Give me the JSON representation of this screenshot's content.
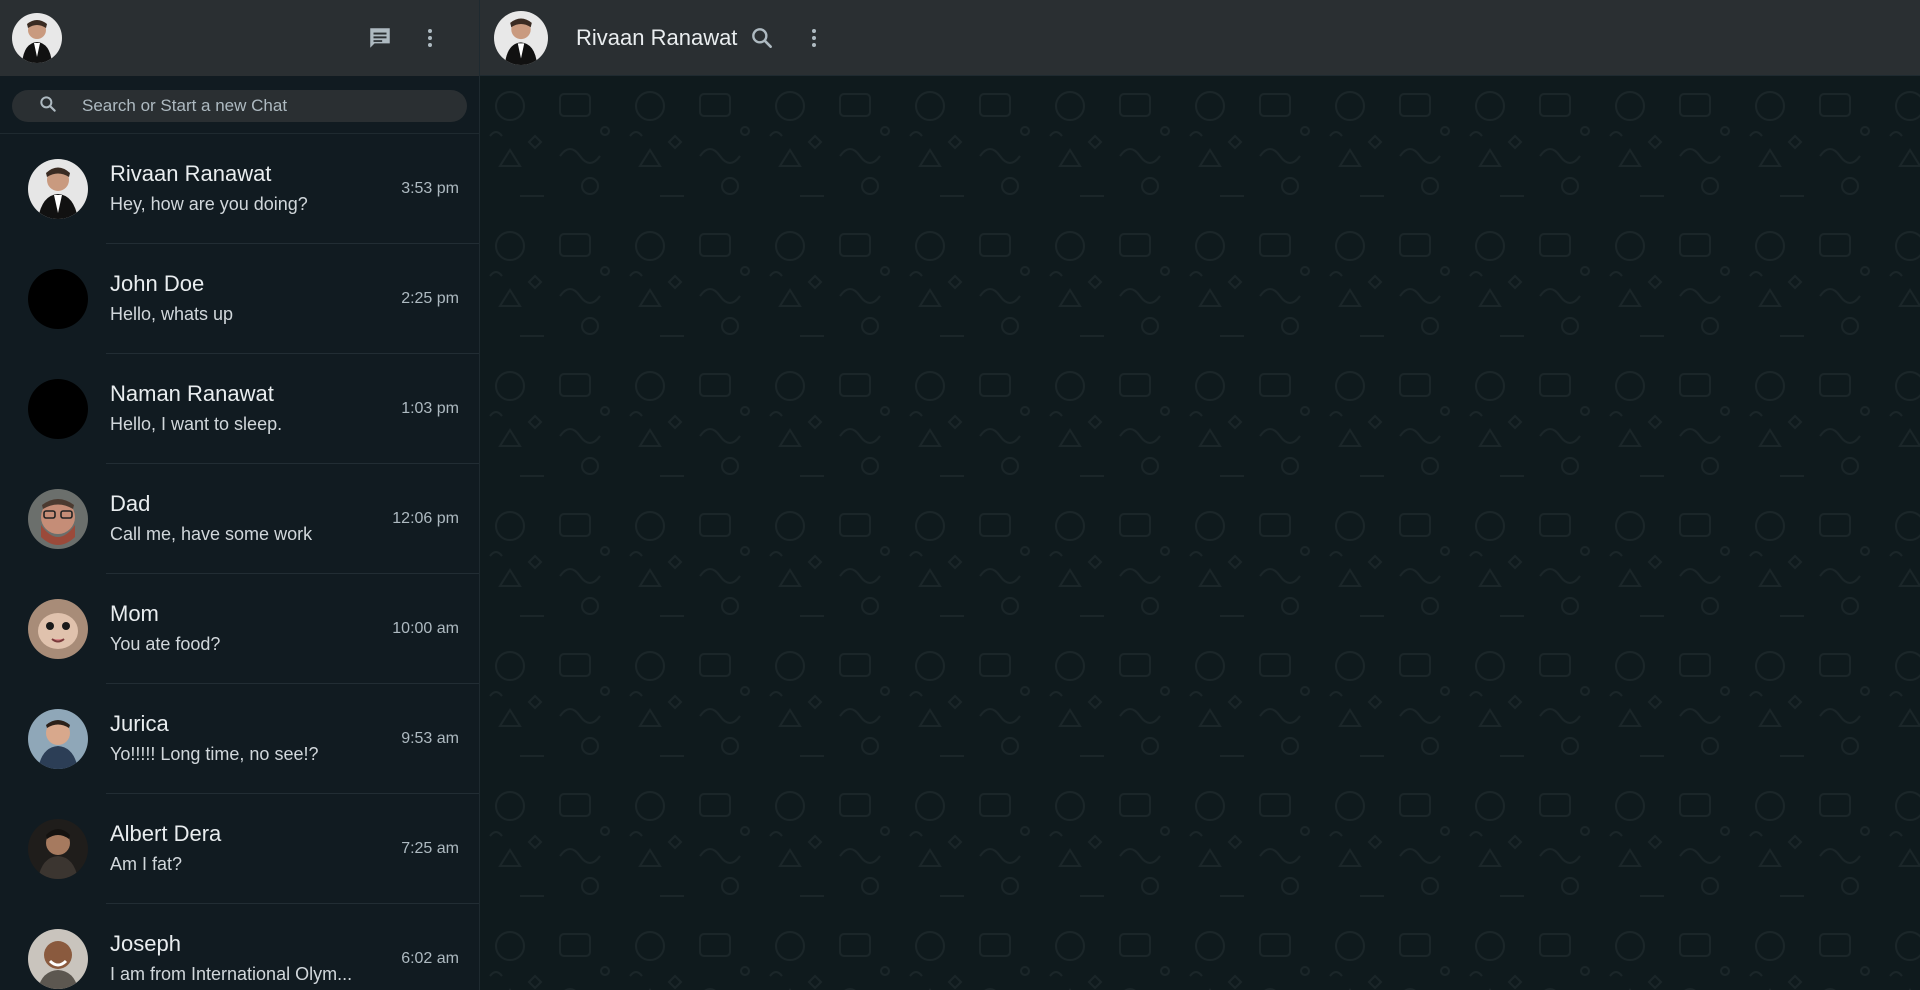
{
  "sidebar": {
    "header": {
      "avatar_icon": "user-avatar-icon",
      "new_chat_icon": "new-chat-icon",
      "menu_icon": "more-vertical-icon"
    },
    "search": {
      "placeholder": "Search or Start a new Chat",
      "icon": "search-icon"
    },
    "chats": [
      {
        "name": "Rivaan Ranawat",
        "preview": "Hey, how are you doing?",
        "time": "3:53 pm",
        "avatar": "photo"
      },
      {
        "name": "John Doe",
        "preview": "Hello, whats up",
        "time": "2:25 pm",
        "avatar": "black"
      },
      {
        "name": "Naman Ranawat",
        "preview": "Hello, I want to sleep.",
        "time": "1:03 pm",
        "avatar": "black"
      },
      {
        "name": "Dad",
        "preview": "Call me, have some work",
        "time": "12:06 pm",
        "avatar": "photo"
      },
      {
        "name": "Mom",
        "preview": "You ate food?",
        "time": "10:00 am",
        "avatar": "photo"
      },
      {
        "name": "Jurica",
        "preview": "Yo!!!!! Long time, no see!?",
        "time": "9:53 am",
        "avatar": "photo"
      },
      {
        "name": "Albert Dera",
        "preview": "Am I fat?",
        "time": "7:25 am",
        "avatar": "photo"
      },
      {
        "name": "Joseph",
        "preview": "I am from International Olym...",
        "time": "6:02 am",
        "avatar": "photo"
      }
    ]
  },
  "main": {
    "contact_name": "Rivaan Ranawat",
    "search_icon": "search-icon",
    "menu_icon": "more-vertical-icon"
  },
  "colors": {
    "header_bg": "#2a2f32",
    "sidebar_bg": "#111b21",
    "chat_bg": "#0f1a1d",
    "text_primary": "#e9edef",
    "text_secondary": "#aebac1"
  }
}
